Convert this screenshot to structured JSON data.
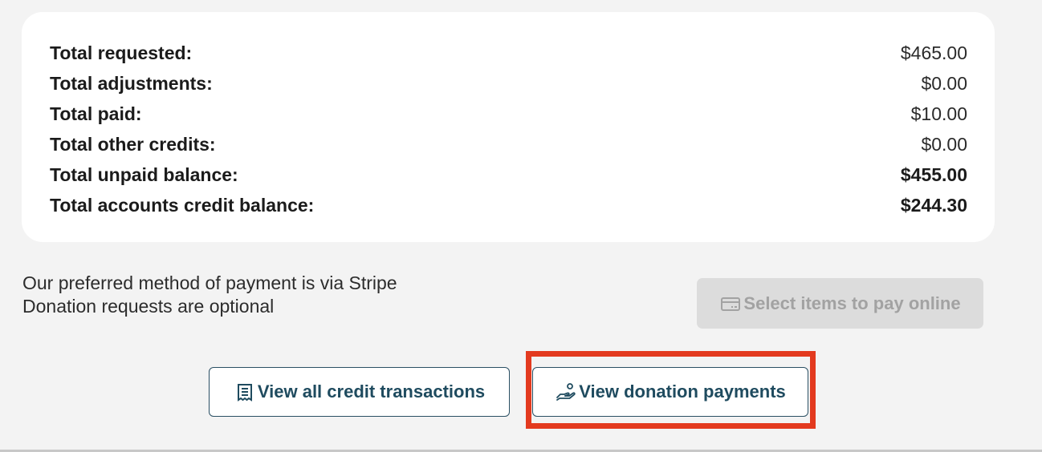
{
  "summary": {
    "rows": [
      {
        "label": "Total requested:",
        "value": "$465.00"
      },
      {
        "label": "Total adjustments:",
        "value": "$0.00"
      },
      {
        "label": "Total paid:",
        "value": "$10.00"
      },
      {
        "label": "Total other credits:",
        "value": "$0.00"
      },
      {
        "label": "Total unpaid balance:",
        "value": "$455.00"
      },
      {
        "label": "Total accounts credit balance:",
        "value": "$244.30"
      }
    ]
  },
  "payment_note": {
    "line1": "Our preferred method of payment is via Stripe",
    "line2": "Donation requests are optional"
  },
  "buttons": {
    "pay_online": {
      "label": "Select items to pay online",
      "icon": "credit-card-icon",
      "enabled": false
    },
    "credit_transactions": {
      "label": "View all credit transactions",
      "icon": "receipt-icon"
    },
    "donation_payments": {
      "label": "View donation payments",
      "icon": "hand-coin-icon"
    }
  },
  "colors": {
    "page_bg": "#f3f3f3",
    "card_bg": "#ffffff",
    "button_text": "#1f4b5f",
    "button_border": "#2a4f63",
    "disabled_bg": "#dcdcdc",
    "disabled_text": "#a2a2a2",
    "highlight": "#e33a1f"
  }
}
